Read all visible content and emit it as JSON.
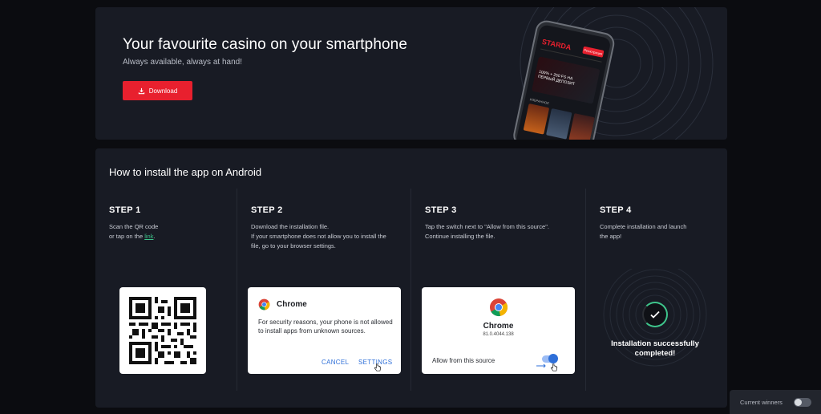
{
  "hero": {
    "title": "Your favourite casino on your smartphone",
    "subtitle": "Always available, always at hand!",
    "download_label": "Download",
    "phone": {
      "logo": "STARDA",
      "button": "Регистрация",
      "banner": "100% + 250 FS НА ПЕРВЫЙ ДЕПОЗИТ",
      "section": "ИЗБРАННОЕ"
    }
  },
  "install": {
    "title": "How to install the app on Android",
    "steps": [
      {
        "label": "STEP 1",
        "line1": "Scan the QR code",
        "line2_prefix": "or tap on the ",
        "link": "link",
        "line2_suffix": "."
      },
      {
        "label": "STEP 2",
        "line1": "Download the installation file.",
        "line2": "If your smartphone does not allow you to install the",
        "line3": "file, go to your browser settings."
      },
      {
        "label": "STEP 3",
        "line1": "Tap the switch next to \"Allow from this source\".",
        "line2": "Continue installing the file."
      },
      {
        "label": "STEP 4",
        "line1": "Complete installation and launch",
        "line2": "the app!"
      }
    ],
    "dialog2": {
      "app": "Chrome",
      "message": "For security reasons, your phone is not allowed to install apps from unknown sources.",
      "cancel": "CANCEL",
      "settings": "SETTINGS"
    },
    "dialog3": {
      "app": "Chrome",
      "version": "81.0.4044.138",
      "allow": "Allow from this source"
    },
    "success": {
      "line1": "Installation successfully",
      "line2": "completed!"
    }
  },
  "winners": {
    "label": "Current winners",
    "enabled": false
  },
  "colors": {
    "accent": "#e8202e",
    "success": "#3ec48b",
    "link": "#2e6fd8",
    "panel": "#181b24",
    "page": "#0b0c10"
  }
}
